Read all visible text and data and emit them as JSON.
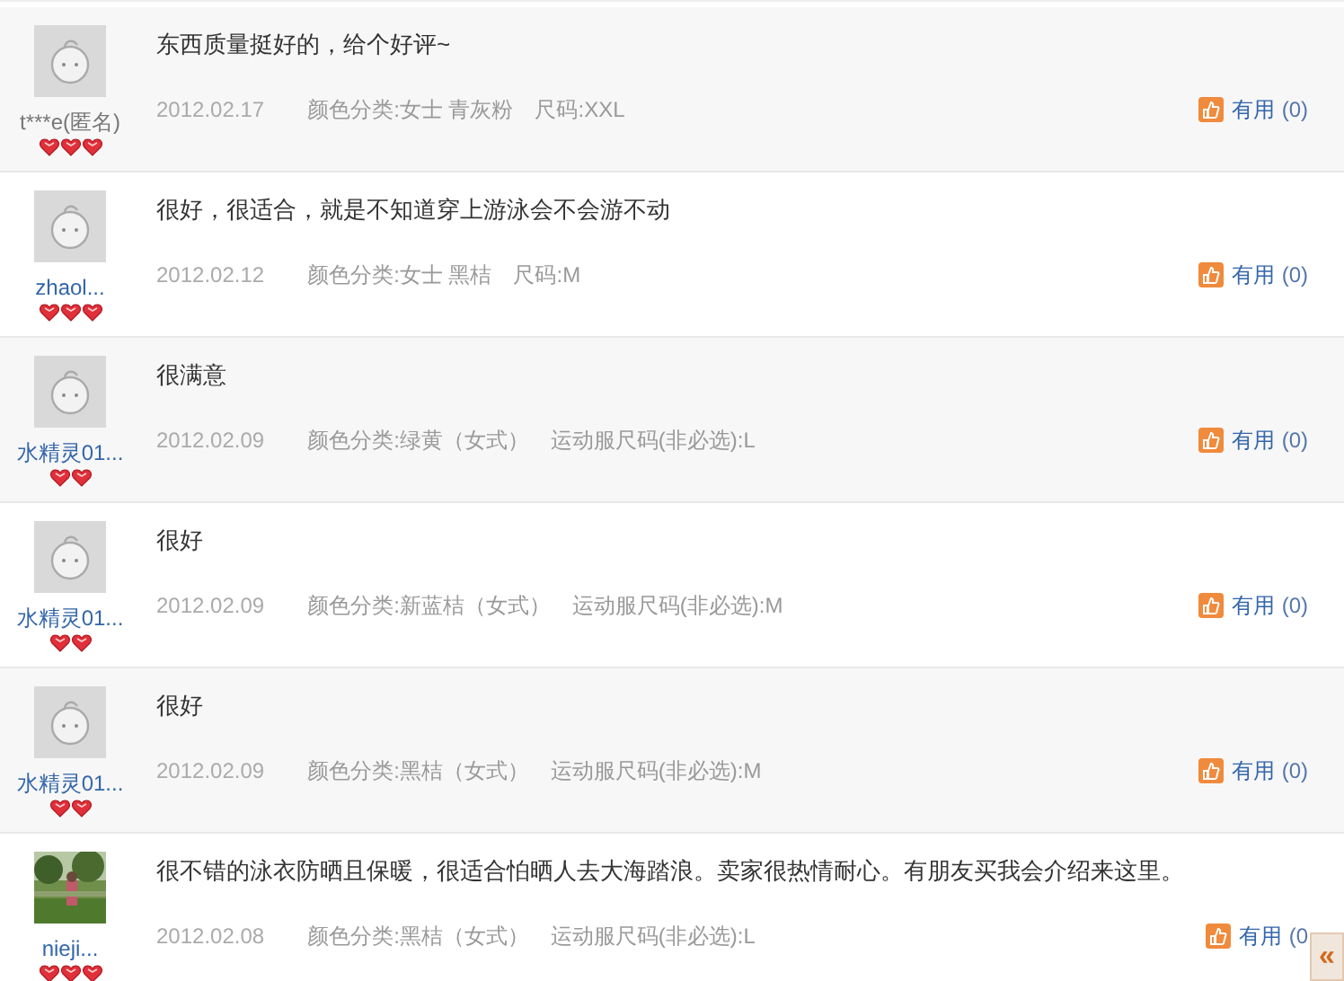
{
  "reviews": [
    {
      "avatar": {
        "kind": "default"
      },
      "user": "t***e(匿名)",
      "anonymous": true,
      "rank_badge": {
        "kind": "three_hearts"
      },
      "comment": "东西质量挺好的，给个好评~",
      "date": "2012.02.17",
      "specs": [
        "颜色分类:女士 青灰粉",
        "尺码:XXL"
      ],
      "useful_label": "有用",
      "useful_count": "(0)"
    },
    {
      "avatar": {
        "kind": "default"
      },
      "user": "zhaol...",
      "anonymous": false,
      "rank_badge": {
        "kind": "three_hearts"
      },
      "comment": "很好，很适合，就是不知道穿上游泳会不会游不动",
      "date": "2012.02.12",
      "specs": [
        "颜色分类:女士 黑桔",
        "尺码:M"
      ],
      "useful_label": "有用",
      "useful_count": "(0)"
    },
    {
      "avatar": {
        "kind": "default"
      },
      "user": "水精灵01...",
      "anonymous": false,
      "rank_badge": {
        "kind": "two_hearts"
      },
      "comment": "很满意",
      "date": "2012.02.09",
      "specs": [
        "颜色分类:绿黄（女式）",
        "运动服尺码(非必选):L"
      ],
      "useful_label": "有用",
      "useful_count": "(0)"
    },
    {
      "avatar": {
        "kind": "default"
      },
      "user": "水精灵01...",
      "anonymous": false,
      "rank_badge": {
        "kind": "two_hearts"
      },
      "comment": "很好",
      "date": "2012.02.09",
      "specs": [
        "颜色分类:新蓝桔（女式）",
        "运动服尺码(非必选):M"
      ],
      "useful_label": "有用",
      "useful_count": "(0)"
    },
    {
      "avatar": {
        "kind": "default"
      },
      "user": "水精灵01...",
      "anonymous": false,
      "rank_badge": {
        "kind": "two_hearts"
      },
      "comment": "很好",
      "date": "2012.02.09",
      "specs": [
        "颜色分类:黑桔（女式）",
        "运动服尺码(非必选):M"
      ],
      "useful_label": "有用",
      "useful_count": "(0)"
    },
    {
      "user": "nieji...",
      "anonymous": false,
      "rank_badge": {
        "kind": "three_hearts"
      },
      "comment": "很不错的泳衣防晒且保暖，很适合怕晒人去大海踏浪。卖家很热情耐心。有朋友买我会介绍来这里。",
      "date": "2012.02.08",
      "specs": [
        "颜色分类:黑桔（女式）",
        "运动服尺码(非必选):L"
      ],
      "useful_label": "有用",
      "useful_count": "(0"
    }
  ],
  "collapse_button": "«"
}
